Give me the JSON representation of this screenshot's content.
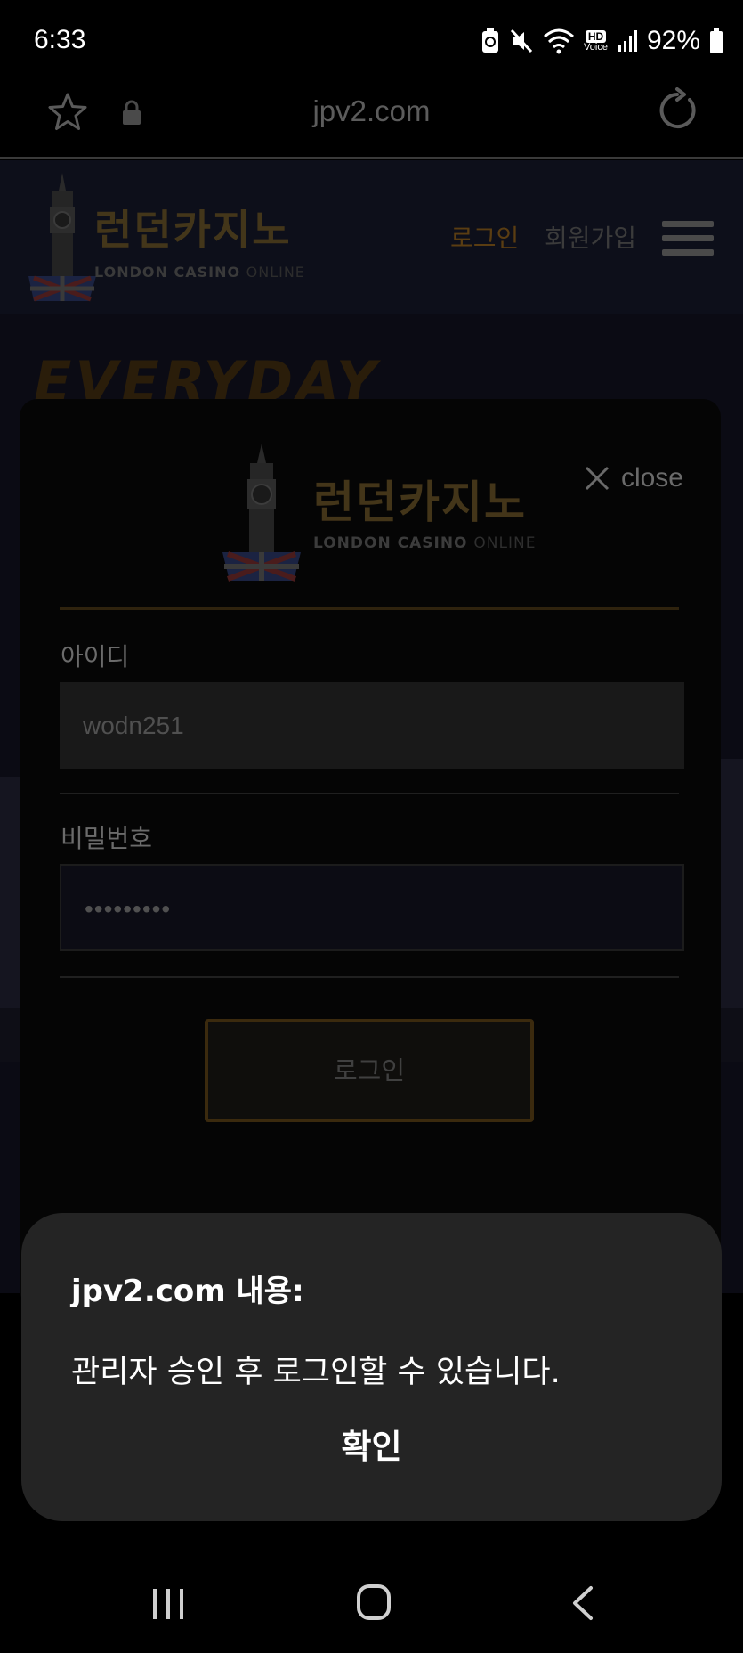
{
  "status_bar": {
    "time": "6:33",
    "battery_percent": "92%",
    "icons": [
      "battery-saver-icon",
      "mute-icon",
      "wifi-icon",
      "hd-voice-icon",
      "signal-icon",
      "battery-icon"
    ],
    "hd_label": "HD",
    "voice_label": "Voice"
  },
  "browser": {
    "url": "jpv2.com",
    "icons": [
      "star-icon",
      "lock-icon",
      "reload-icon"
    ]
  },
  "site_header": {
    "logo_title": "런던카지노",
    "logo_sub_bold": "LONDON CASINO",
    "logo_sub_light": "ONLINE",
    "nav_login": "로그인",
    "nav_signup": "회원가입",
    "menu_icon": "hamburger-menu-icon"
  },
  "banner": {
    "text": "EVERYDAY"
  },
  "login_modal": {
    "logo_title": "런던카지노",
    "logo_sub_bold": "LONDON CASINO",
    "logo_sub_light": "ONLINE",
    "close_label": "close",
    "id_label": "아이디",
    "id_value": "wodn251",
    "password_label": "비밀번호",
    "password_value": "•••••••••",
    "login_button": "로그인"
  },
  "alert_dialog": {
    "title": "jpv2.com 내용:",
    "message": "관리자 승인 후 로그인할 수 있습니다.",
    "confirm_button": "확인"
  },
  "colors": {
    "gold": "#c8922c",
    "dialog_bg": "#242424",
    "page_bg": "#000000"
  }
}
